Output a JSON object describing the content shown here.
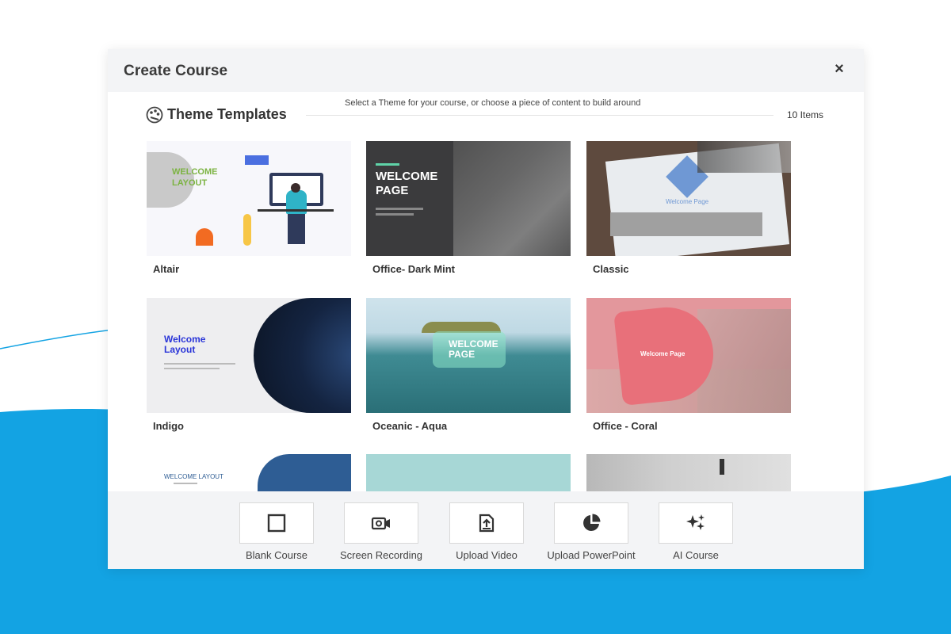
{
  "dialog": {
    "title": "Create Course",
    "close_symbol": "×"
  },
  "section": {
    "title": "Theme Templates",
    "icon": "palette-icon",
    "instruction": "Select a Theme for your course, or choose a piece of content to build around",
    "count": "10 Items"
  },
  "themes": [
    {
      "name": "Altair",
      "thumb_text": "WELCOME LAYOUT"
    },
    {
      "name": "Office- Dark Mint",
      "thumb_text": "WELCOME PAGE"
    },
    {
      "name": "Classic",
      "thumb_text": "Welcome Page"
    },
    {
      "name": "Indigo",
      "thumb_text": "Welcome Layout"
    },
    {
      "name": "Oceanic - Aqua",
      "thumb_text": "WELCOME PAGE"
    },
    {
      "name": "Office - Coral",
      "thumb_text": "Welcome Page"
    },
    {
      "name": "",
      "thumb_text": "WELCOME LAYOUT"
    },
    {
      "name": "",
      "thumb_text": ""
    },
    {
      "name": "",
      "thumb_text": ""
    }
  ],
  "options": [
    {
      "label": "Blank Course",
      "icon": "square-icon"
    },
    {
      "label": "Screen Recording",
      "icon": "video-camera-icon"
    },
    {
      "label": "Upload Video",
      "icon": "upload-file-icon"
    },
    {
      "label": "Upload PowerPoint",
      "icon": "pie-chart-icon"
    },
    {
      "label": "AI Course",
      "icon": "sparkles-icon"
    }
  ],
  "colors": {
    "accent_blue": "#13a3e3",
    "header_bg": "#f3f4f6",
    "dark_mint": "#3a3a3a",
    "indigo_text": "#2a35d8",
    "coral": "#e8707a"
  }
}
